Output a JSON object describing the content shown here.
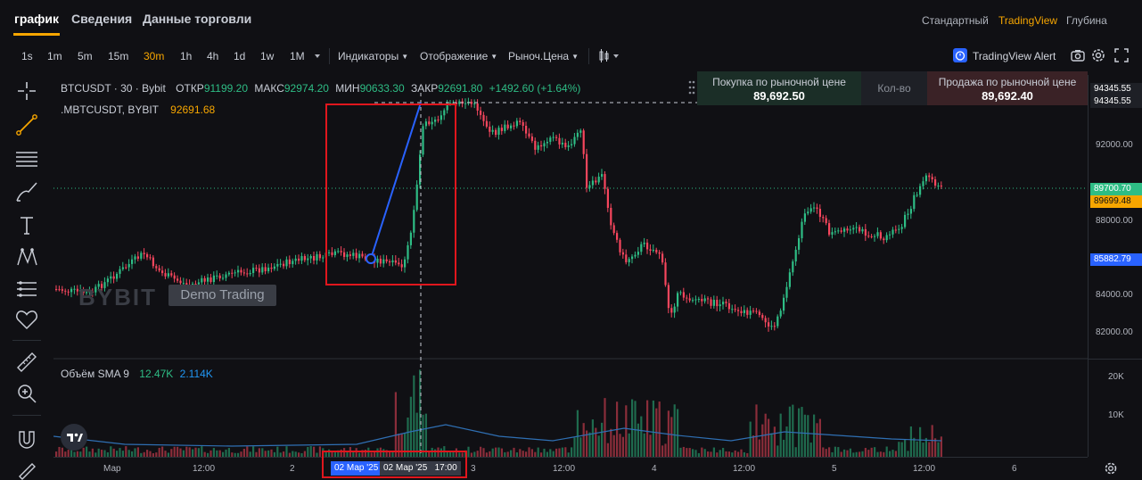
{
  "header": {
    "tabs": [
      "график",
      "Сведения",
      "Данные торговли"
    ],
    "active_tab": "график",
    "views": [
      "Стандартный",
      "TradingView",
      "Глубина"
    ],
    "active_view": "TradingView"
  },
  "toolbar": {
    "intervals": [
      "1s",
      "1m",
      "5m",
      "15m",
      "30m",
      "1h",
      "4h",
      "1d",
      "1w",
      "1M"
    ],
    "active_interval": "30m",
    "indicators_label": "Индикаторы",
    "display_label": "Отображение",
    "price_type_label": "Рыноч.Цена",
    "alert_label": "TradingView Alert"
  },
  "legend": {
    "symbol": "BTCUSDT · 30 · Bybit",
    "open_label": "ОТКР",
    "open": "91199.20",
    "high_label": "МАКС",
    "high": "92974.20",
    "low_label": "МИН",
    "low": "90633.30",
    "close_label": "ЗАКР",
    "close": "92691.80",
    "change": "+1492.60 (+1.64%)",
    "mark_symbol": ".MBTCUSDT, BYBIT",
    "mark_value": "92691.68"
  },
  "order": {
    "buy_label": "Покупка по рыночной цене",
    "buy_price": "89,692.50",
    "qty_label": "Кол-во",
    "sell_label": "Продажа по рыночной цене",
    "sell_price": "89,692.40"
  },
  "price_axis": {
    "labels": [
      "92000.00",
      "88000.00",
      "84000.00",
      "82000.00"
    ],
    "tag_top1": "94345.55",
    "tag_top2": "94345.55",
    "tag_last": "89700.70",
    "tag_mark": "89699.48",
    "tag_cursor": "85882.79"
  },
  "volume": {
    "label": "Объём SMA 9",
    "v1": "12.47K",
    "v2": "2.114K",
    "axis": [
      "20K",
      "10K"
    ]
  },
  "time_axis": {
    "labels": [
      "Мар",
      "12:00",
      "2",
      "12:00",
      "3",
      "12:00",
      "4",
      "12:00",
      "5",
      "12:00",
      "6"
    ],
    "cursor_date1": "02 Мар '25",
    "cursor_date2": "02 Мар '25",
    "cursor_time": "17:00"
  },
  "watermark": {
    "brand": "BYBIT",
    "demo": "Demo Trading"
  },
  "colors": {
    "up": "#2ebd85",
    "down": "#f6465d",
    "accent": "#f7a600",
    "line_tool": "#2962ff",
    "highlight": "#e0161d"
  }
}
